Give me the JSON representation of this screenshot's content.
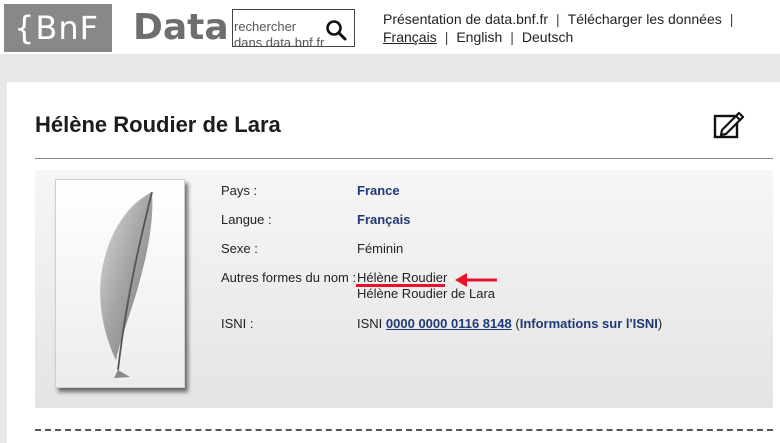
{
  "header": {
    "logo_bnf": "{BnF",
    "logo_data": "Data",
    "search_placeholder": "rechercher dans data.bnf.fr",
    "nav_top": [
      "Présentation de data.bnf.fr",
      "Télécharger les données"
    ],
    "separator": "|",
    "languages": [
      "Français",
      "English",
      "Deutsch"
    ],
    "current_language": "Français"
  },
  "record": {
    "title": "Hélène Roudier de Lara",
    "fields": {
      "pays_label": "Pays :",
      "pays_value": "France",
      "langue_label": "Langue :",
      "langue_value": "Français",
      "sexe_label": "Sexe :",
      "sexe_value": "Féminin",
      "autres_label": "Autres formes du nom :",
      "autres_values": [
        "Hélène Roudier",
        "Hélène Roudier de Lara"
      ],
      "isni_label": "ISNI :",
      "isni_prefix": "ISNI",
      "isni_number": "0000 0000 0116 8148",
      "isni_open": "(",
      "isni_info": "Informations sur l'ISNI",
      "isni_close": ")"
    }
  },
  "colors": {
    "link": "#1f3a78",
    "annotation": "#e8102a",
    "logo_bg": "#888888"
  },
  "icons": [
    "search-icon",
    "edit-icon",
    "quill-icon",
    "arrow-left-icon"
  ]
}
